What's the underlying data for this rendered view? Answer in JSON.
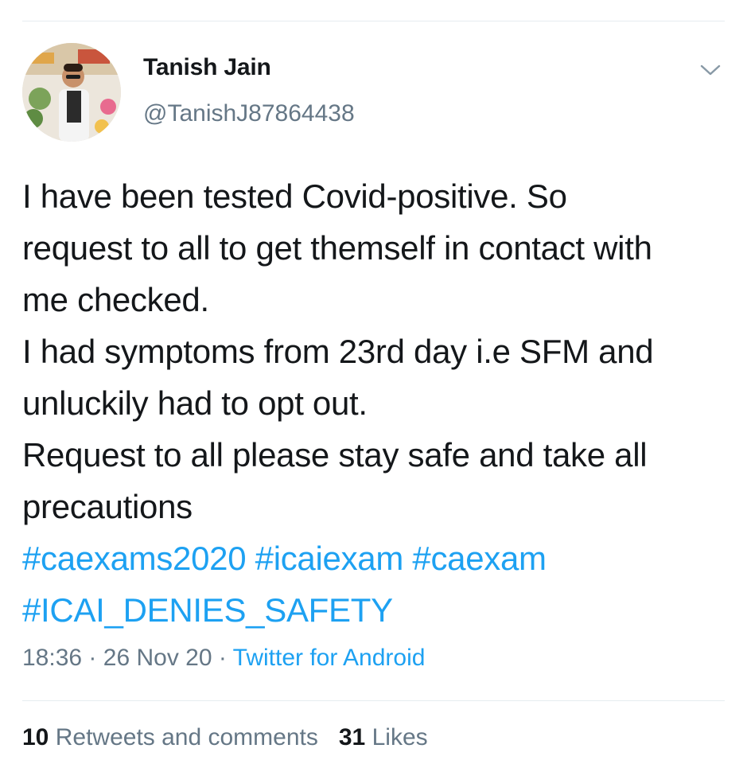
{
  "tweet": {
    "author": {
      "name": "Tanish Jain",
      "handle": "@TanishJ87864438"
    },
    "text_lines": [
      "I have been tested Covid-positive. So",
      "request to all to get themself in contact with",
      "me checked.",
      "I had symptoms from 23rd day i.e SFM and",
      "unluckily had to opt out.",
      "Request to all please stay safe and take all",
      "precautions"
    ],
    "hashtags": [
      "#caexams2020",
      "#icaiexam",
      "#caexam",
      "#ICAI_DENIES_SAFETY"
    ],
    "time": "18:36",
    "date": "26 Nov 20",
    "separator": "·",
    "source": "Twitter for Android",
    "stats": {
      "retweets_count": "10",
      "retweets_label": "Retweets and comments",
      "likes_count": "31",
      "likes_label": "Likes"
    }
  },
  "colors": {
    "link": "#1da1f2",
    "muted": "#657786",
    "text": "#14171a",
    "divider": "#e6ecf0"
  },
  "icons": {
    "menu": "chevron-down-icon"
  }
}
